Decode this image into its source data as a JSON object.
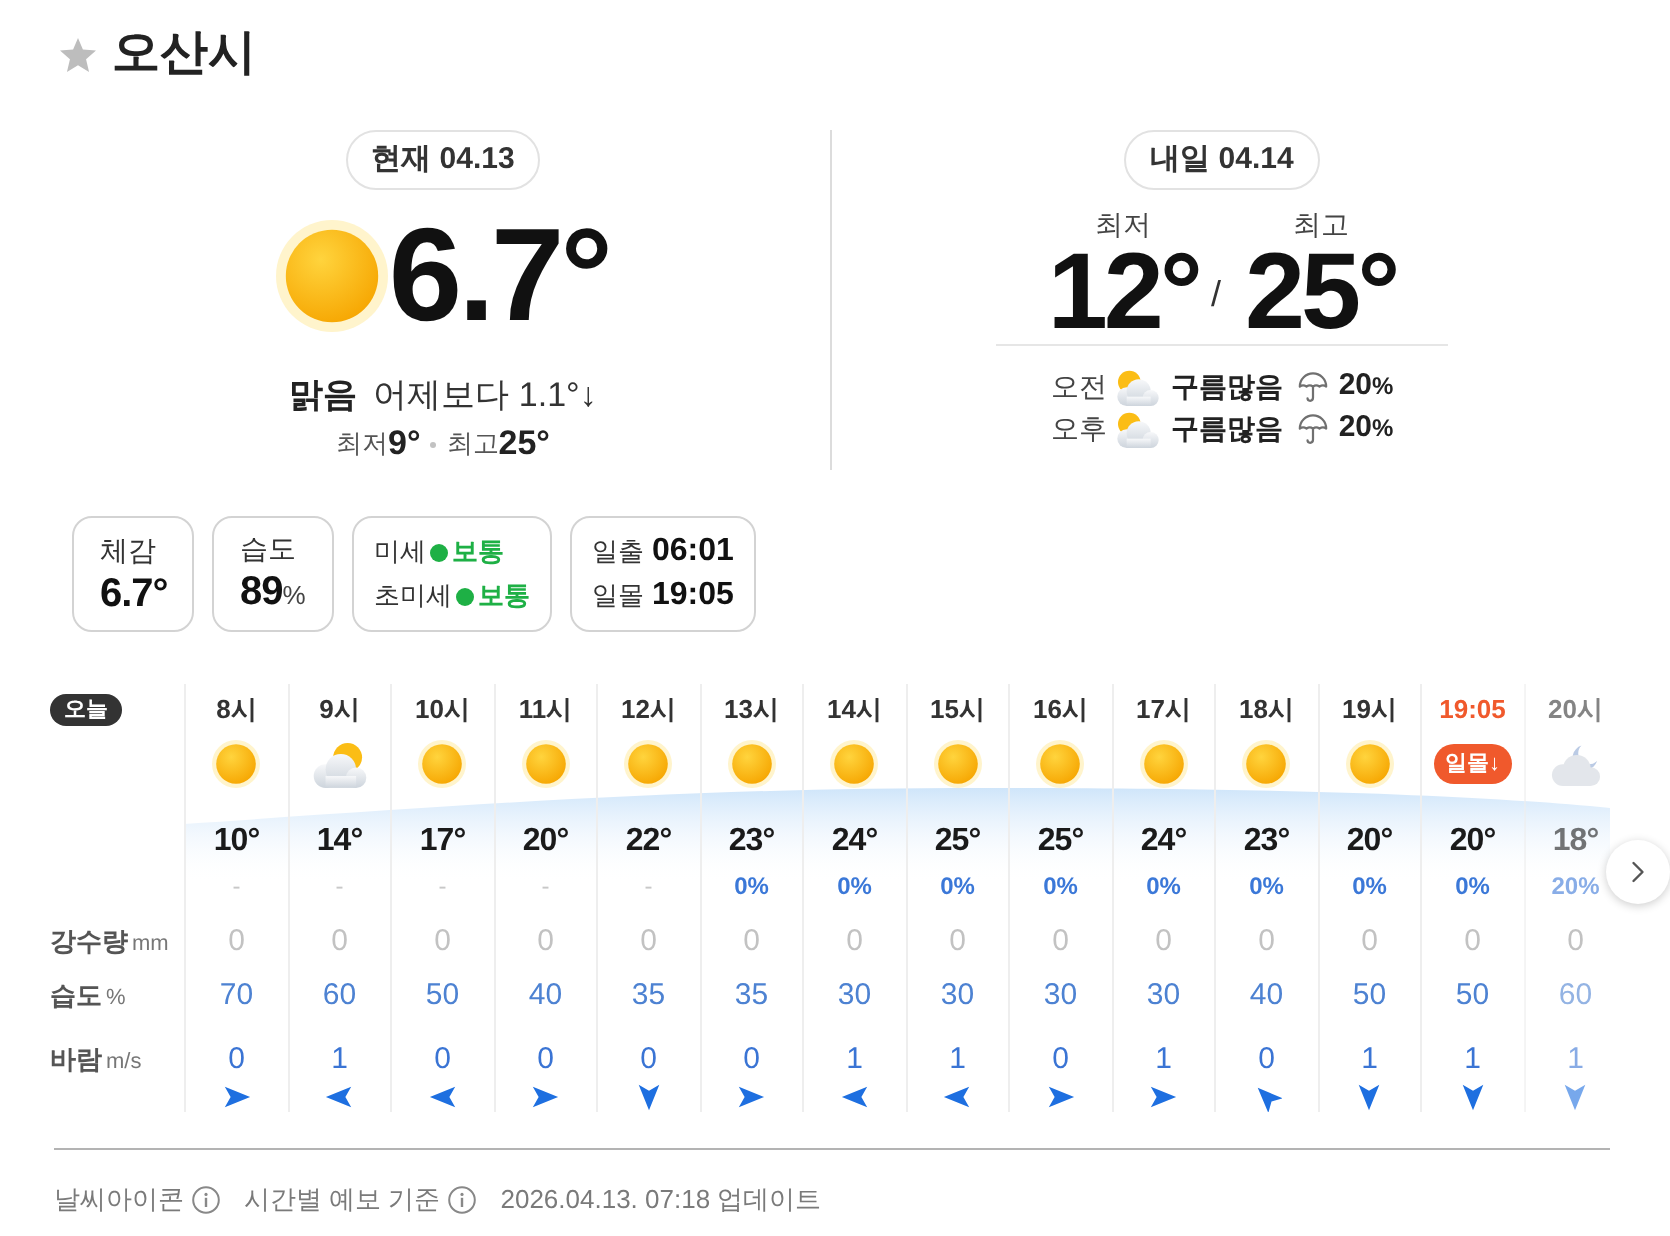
{
  "header": {
    "city": "오산시",
    "starred": false
  },
  "today": {
    "badge": "현재 04.13",
    "temperature": "6.7°",
    "condition": "맑음",
    "comparison": "어제보다 1.1°↓",
    "low_label": "최저",
    "low": "9°",
    "high_label": "최고",
    "high": "25°"
  },
  "tomorrow": {
    "badge": "내일 04.14",
    "low_label": "최저",
    "low": "12°",
    "separator": "/",
    "high_label": "최고",
    "high": "25°",
    "periods": [
      {
        "label": "오전",
        "condition": "구름많음",
        "chance": "20",
        "unit": "%"
      },
      {
        "label": "오후",
        "condition": "구름많음",
        "chance": "20",
        "unit": "%"
      }
    ]
  },
  "cards": [
    {
      "kind": "stat",
      "label": "체감",
      "value": "6.7°"
    },
    {
      "kind": "stat",
      "label": "습도",
      "value": "89",
      "unit": "%"
    },
    {
      "kind": "status",
      "rows": [
        {
          "label": "미세",
          "status": "보통",
          "color": "#1eb045"
        },
        {
          "label": "초미세",
          "status": "보통",
          "color": "#1eb045"
        }
      ]
    },
    {
      "kind": "times",
      "rows": [
        {
          "label": "일출",
          "time": "06:01"
        },
        {
          "label": "일몰",
          "time": "19:05"
        }
      ]
    }
  ],
  "hourly": {
    "day_label": "오늘",
    "row_labels": [
      {
        "label": "강수량",
        "unit": "mm"
      },
      {
        "label": "습도",
        "unit": "%"
      },
      {
        "label": "바람",
        "unit": "m/s"
      }
    ],
    "columns": [
      {
        "time": "8시",
        "kind": "clear",
        "temp": "10°",
        "chance": "-",
        "chance_available": false,
        "rain": "0",
        "humidity": "70",
        "wind": "0",
        "wind_arrow": {
          "kind": "east"
        }
      },
      {
        "time": "9시",
        "kind": "partly_cloudy",
        "temp": "14°",
        "chance": "-",
        "chance_available": false,
        "rain": "0",
        "humidity": "60",
        "wind": "1",
        "wind_arrow": {
          "kind": "west"
        }
      },
      {
        "time": "10시",
        "kind": "clear",
        "temp": "17°",
        "chance": "-",
        "chance_available": false,
        "rain": "0",
        "humidity": "50",
        "wind": "0",
        "wind_arrow": {
          "kind": "west"
        }
      },
      {
        "time": "11시",
        "kind": "clear",
        "temp": "20°",
        "chance": "-",
        "chance_available": false,
        "rain": "0",
        "humidity": "40",
        "wind": "0",
        "wind_arrow": {
          "kind": "east"
        }
      },
      {
        "time": "12시",
        "kind": "clear",
        "temp": "22°",
        "chance": "-",
        "chance_available": false,
        "rain": "0",
        "humidity": "35",
        "wind": "0",
        "wind_arrow": {
          "kind": "south"
        }
      },
      {
        "time": "13시",
        "kind": "clear",
        "temp": "23°",
        "chance": "0%",
        "chance_available": true,
        "rain": "0",
        "humidity": "35",
        "wind": "0",
        "wind_arrow": {
          "kind": "east"
        }
      },
      {
        "time": "14시",
        "kind": "clear",
        "temp": "24°",
        "chance": "0%",
        "chance_available": true,
        "rain": "0",
        "humidity": "30",
        "wind": "1",
        "wind_arrow": {
          "kind": "west"
        }
      },
      {
        "time": "15시",
        "kind": "clear",
        "temp": "25°",
        "chance": "0%",
        "chance_available": true,
        "rain": "0",
        "humidity": "30",
        "wind": "1",
        "wind_arrow": {
          "kind": "west"
        }
      },
      {
        "time": "16시",
        "kind": "clear",
        "temp": "25°",
        "chance": "0%",
        "chance_available": true,
        "rain": "0",
        "humidity": "30",
        "wind": "0",
        "wind_arrow": {
          "kind": "east"
        }
      },
      {
        "time": "17시",
        "kind": "clear",
        "temp": "24°",
        "chance": "0%",
        "chance_available": true,
        "rain": "0",
        "humidity": "30",
        "wind": "1",
        "wind_arrow": {
          "kind": "east"
        }
      },
      {
        "time": "18시",
        "kind": "clear",
        "temp": "23°",
        "chance": "0%",
        "chance_available": true,
        "rain": "0",
        "humidity": "40",
        "wind": "0",
        "wind_arrow": {
          "kind": "northwest"
        }
      },
      {
        "time": "19시",
        "kind": "clear",
        "temp": "20°",
        "chance": "0%",
        "chance_available": true,
        "rain": "0",
        "humidity": "50",
        "wind": "1",
        "wind_arrow": {
          "kind": "south"
        }
      },
      {
        "time": "19:05",
        "kind": "sunset",
        "badge": "일몰↓",
        "temp": "20°",
        "chance": "0%",
        "chance_available": true,
        "rain": "0",
        "humidity": "50",
        "wind": "1",
        "wind_arrow": {
          "kind": "south"
        }
      },
      {
        "time": "20시",
        "kind": "cloudy_night",
        "temp": "18°",
        "chance": "20%",
        "chance_available": true,
        "rain": "0",
        "humidity": "60",
        "wind": "1",
        "wind_arrow": {
          "kind": "south"
        }
      }
    ]
  },
  "footer": {
    "links": [
      {
        "label": "날씨아이콘"
      },
      {
        "label": "시간별 예보 기준"
      }
    ],
    "updated": "2026.04.13. 07:18 업데이트"
  }
}
